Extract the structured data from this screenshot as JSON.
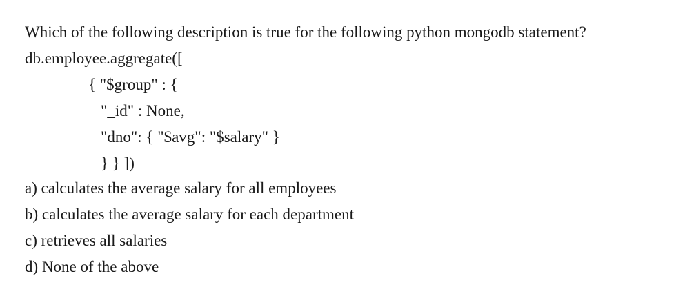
{
  "question": "Which of the following description is true for the following python mongodb statement?",
  "code_lines": [
    "db.employee.aggregate([",
    "{ \"$group\" : {",
    "\"_id\" : None,",
    "\"dno\": { \"$avg\": \"$salary\" }",
    "} } ])"
  ],
  "options": [
    "a) calculates the average salary for all employees",
    "b) calculates the average salary for each department",
    "c) retrieves all salaries",
    "d) None of the above"
  ]
}
